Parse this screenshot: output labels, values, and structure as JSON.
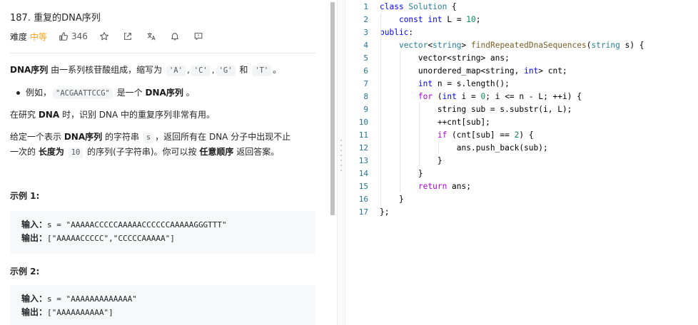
{
  "problem": {
    "title": "187. 重复的DNA序列",
    "difficulty_label": "难度",
    "difficulty": "中等",
    "like_count": "346"
  },
  "description": {
    "p1_bold": "DNA序列",
    "p1_text": "由一系列核苷酸组成，缩写为",
    "nucleotides": [
      "'A'",
      "'C'",
      "'G'",
      "'T'"
    ],
    "sep1": ",",
    "sep2": ",",
    "and_word": "和",
    "p1_end": "。",
    "bullet_prefix": "例如，",
    "bullet_code": "\"ACGAATTCCG\"",
    "bullet_mid": "是一个",
    "bullet_bold": "DNA序列",
    "bullet_end": "。",
    "p2_a": "在研究",
    "p2_bold": "DNA",
    "p2_b": "时，识别 DNA 中的重复序列非常有用。",
    "p3_a": "给定一个表示",
    "p3_bold": "DNA序列",
    "p3_b": "的字符串",
    "p3_code": "s",
    "p3_c": "，返回所有在 DNA 分子中出现不止",
    "p3_d": "一次的",
    "p3_bold2": "长度为",
    "p3_code2": "10",
    "p3_e": "的序列(子字符串)。你可以按",
    "p3_bold3": "任意顺序",
    "p3_f": "返回答案。"
  },
  "examples": [
    {
      "heading": "示例 1:",
      "input_label": "输入：",
      "input": "s = \"AAAAACCCCCAAAAACCCCCCAAAAAGGGTTT\"",
      "output_label": "输出：",
      "output": "[\"AAAAACCCCC\",\"CCCCCAAAAA\"]"
    },
    {
      "heading": "示例 2:",
      "input_label": "输入：",
      "input": "s = \"AAAAAAAAAAAAA\"",
      "output_label": "输出：",
      "output": "[\"AAAAAAAAAA\"]"
    }
  ],
  "editor": {
    "line_numbers": [
      "1",
      "2",
      "3",
      "4",
      "5",
      "6",
      "7",
      "8",
      "9",
      "10",
      "11",
      "12",
      "13",
      "14",
      "15",
      "16",
      "17"
    ],
    "lines": [
      [
        {
          "t": "class ",
          "c": "kw"
        },
        {
          "t": "Solution",
          "c": "ty"
        },
        {
          "t": " {",
          "c": ""
        }
      ],
      [
        {
          "t": "    ",
          "c": ""
        },
        {
          "t": "const",
          "c": "kw"
        },
        {
          "t": " ",
          "c": ""
        },
        {
          "t": "int",
          "c": "kw"
        },
        {
          "t": " L = ",
          "c": ""
        },
        {
          "t": "10",
          "c": "num"
        },
        {
          "t": ";",
          "c": ""
        }
      ],
      [
        {
          "t": "public",
          "c": "kw"
        },
        {
          "t": ":",
          "c": ""
        }
      ],
      [
        {
          "t": "    ",
          "c": ""
        },
        {
          "t": "vector",
          "c": "ty"
        },
        {
          "t": "<",
          "c": ""
        },
        {
          "t": "string",
          "c": "ty"
        },
        {
          "t": "> ",
          "c": ""
        },
        {
          "t": "findRepeatedDnaSequences",
          "c": "fn"
        },
        {
          "t": "(",
          "c": ""
        },
        {
          "t": "string",
          "c": "ty"
        },
        {
          "t": " s) {",
          "c": ""
        }
      ],
      [
        {
          "t": "        vector<string> ans;",
          "c": ""
        }
      ],
      [
        {
          "t": "        unordered_map<string, ",
          "c": ""
        },
        {
          "t": "int",
          "c": "kw"
        },
        {
          "t": "> cnt;",
          "c": ""
        }
      ],
      [
        {
          "t": "        ",
          "c": ""
        },
        {
          "t": "int",
          "c": "kw"
        },
        {
          "t": " n = s.length();",
          "c": ""
        }
      ],
      [
        {
          "t": "        ",
          "c": ""
        },
        {
          "t": "for",
          "c": "ctl"
        },
        {
          "t": " (",
          "c": ""
        },
        {
          "t": "int",
          "c": "kw"
        },
        {
          "t": " i = ",
          "c": ""
        },
        {
          "t": "0",
          "c": "num"
        },
        {
          "t": "; i <= n - L; ++i) {",
          "c": ""
        }
      ],
      [
        {
          "t": "            string sub = s.substr(i, L);",
          "c": ""
        }
      ],
      [
        {
          "t": "            ++cnt[sub];",
          "c": ""
        }
      ],
      [
        {
          "t": "            ",
          "c": ""
        },
        {
          "t": "if",
          "c": "ctl"
        },
        {
          "t": " (cnt[sub] == ",
          "c": ""
        },
        {
          "t": "2",
          "c": "num"
        },
        {
          "t": ") {",
          "c": ""
        }
      ],
      [
        {
          "t": "                ans.push_back(sub);",
          "c": ""
        }
      ],
      [
        {
          "t": "            }",
          "c": ""
        }
      ],
      [
        {
          "t": "        }",
          "c": ""
        }
      ],
      [
        {
          "t": "        ",
          "c": ""
        },
        {
          "t": "return",
          "c": "ctl"
        },
        {
          "t": " ans;",
          "c": ""
        }
      ],
      [
        {
          "t": "    }",
          "c": ""
        }
      ],
      [
        {
          "t": "};",
          "c": ""
        }
      ]
    ]
  }
}
